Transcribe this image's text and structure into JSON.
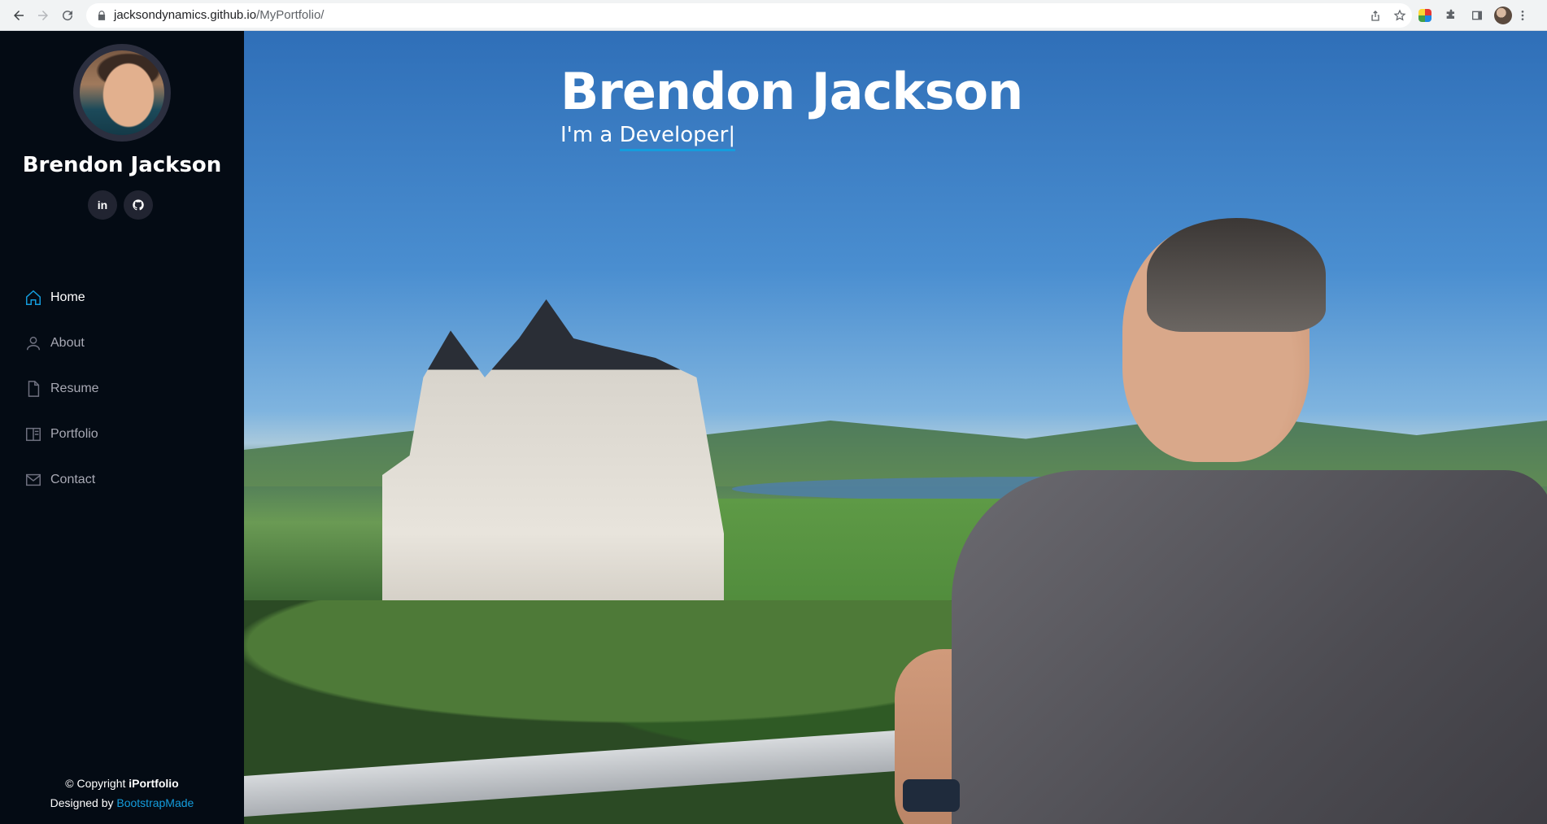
{
  "browser": {
    "url_host": "jacksondynamics.github.io",
    "url_path": "/MyPortfolio/"
  },
  "sidebar": {
    "name": "Brendon Jackson",
    "social": [
      {
        "label": "in",
        "icon": "linkedin-icon"
      },
      {
        "label": "",
        "icon": "github-icon"
      }
    ],
    "nav": [
      {
        "label": "Home",
        "icon": "home-icon",
        "active": true
      },
      {
        "label": "About",
        "icon": "person-icon",
        "active": false
      },
      {
        "label": "Resume",
        "icon": "file-icon",
        "active": false
      },
      {
        "label": "Portfolio",
        "icon": "book-icon",
        "active": false
      },
      {
        "label": "Contact",
        "icon": "envelope-icon",
        "active": false
      }
    ],
    "footer": {
      "copyright_prefix": "© Copyright",
      "brand": "iPortfolio",
      "designed_prefix": "Designed by",
      "designer": "BootstrapMade"
    }
  },
  "hero": {
    "title": "Brendon Jackson",
    "subtitle_prefix": "I'm a",
    "typed_word": "Developer|"
  },
  "colors": {
    "accent": "#149ddd",
    "sidebar_bg": "#040b14"
  }
}
